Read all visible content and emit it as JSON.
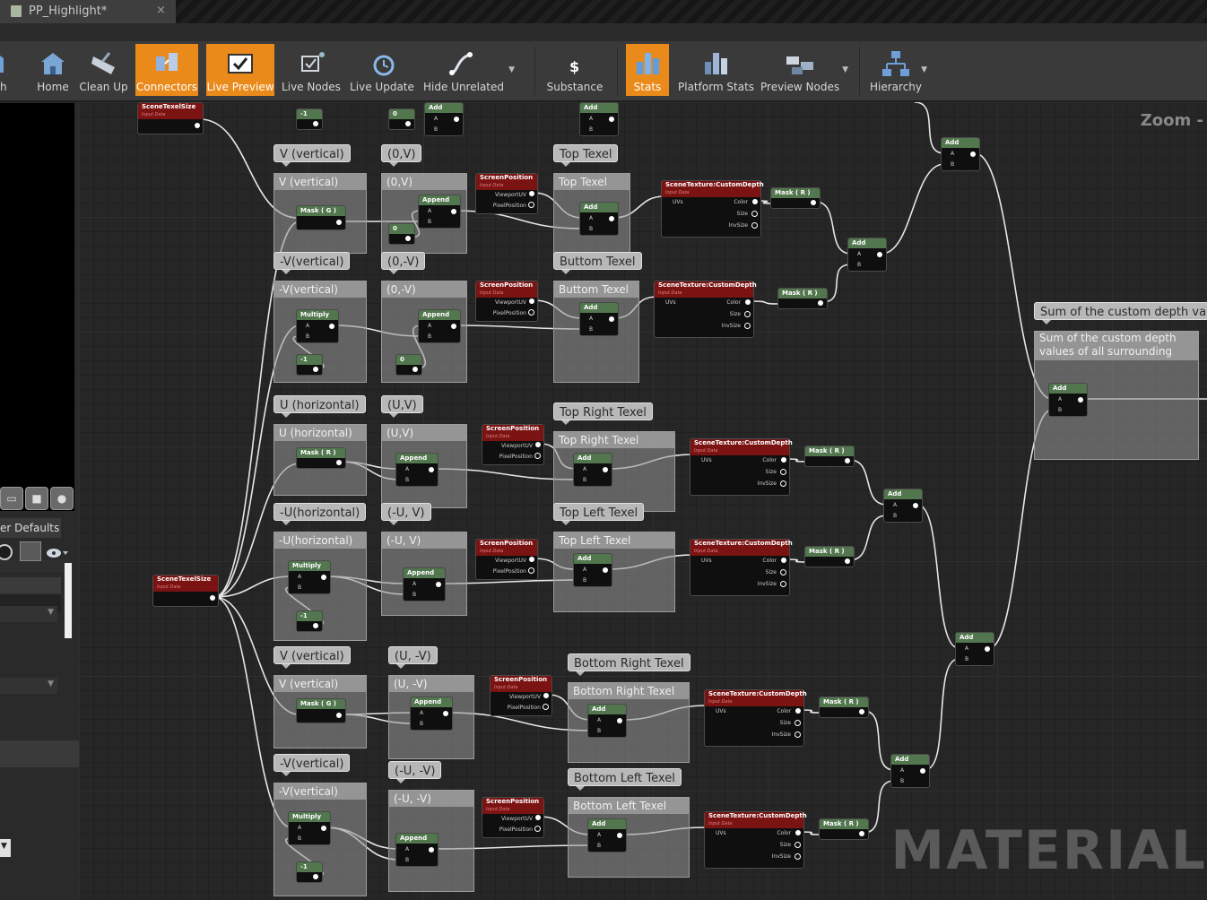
{
  "tab": {
    "title": "PP_Highlight*",
    "close": "×"
  },
  "toolbar": [
    {
      "label": "h",
      "id": "partial",
      "active": false
    },
    {
      "label": "Home",
      "id": "home",
      "active": false
    },
    {
      "label": "Clean Up",
      "id": "cleanup",
      "active": false
    },
    {
      "label": "Connectors",
      "id": "connectors",
      "active": true
    },
    {
      "label": "Live Preview",
      "id": "livepreview",
      "active": true
    },
    {
      "label": "Live Nodes",
      "id": "livenodes",
      "active": false
    },
    {
      "label": "Live Update",
      "id": "liveupdate",
      "active": false
    },
    {
      "label": "Hide Unrelated",
      "id": "hideunrelated",
      "active": false
    },
    {
      "label": "Substance",
      "id": "substance",
      "active": false
    },
    {
      "label": "Stats",
      "id": "stats",
      "active": true
    },
    {
      "label": "Platform Stats",
      "id": "platformstats",
      "active": false
    },
    {
      "label": "Preview Nodes",
      "id": "previewnodes",
      "active": false
    },
    {
      "label": "Hierarchy",
      "id": "hierarchy",
      "active": false
    }
  ],
  "details_tab": "er Defaults",
  "graph": {
    "zoom_label": "Zoom -",
    "watermark": "MATERIAL",
    "bubbles": [
      "V (vertical)",
      "(0,V)",
      "Top Texel",
      "-V(vertical)",
      "(0,-V)",
      "Buttom Texel",
      "U (horizontal)",
      "(U,V)",
      "Top Right Texel",
      "-U(horizontal)",
      "(-U, V)",
      "Top Left Texel",
      "V (vertical)",
      "(U, -V)",
      "Bottom Right Texel",
      "-V(vertical)",
      "(-U, -V)",
      "Bottom Left Texel",
      "Sum of the custom depth values"
    ],
    "comments": [
      "V (vertical)",
      "(0,V)",
      "Top Texel",
      "-V(vertical)",
      "(0,-V)",
      "Buttom Texel",
      "U (horizontal)",
      "(U,V)",
      "Top Right Texel",
      "-U(horizontal)",
      "(-U, V)",
      "Top Left Texel",
      "V (vertical)",
      "(U, -V)",
      "Bottom Right Texel",
      "-V(vertical)",
      "(-U, -V)",
      "Bottom Left Texel",
      "Sum of the custom depth values of all surrounding texels"
    ],
    "node_labels": {
      "add": "Add",
      "append": "Append",
      "multiply": "Multiply",
      "mask_g": "Mask ( G )",
      "mask_r": "Mask ( R )",
      "screen_position": "ScreenPosition",
      "scene_texture": "SceneTexture:CustomDepth",
      "scene_texel_size": "SceneTexelSize",
      "input_data": "Input Data",
      "const_zero": "0",
      "const_neg_one": "-1",
      "pin_a": "A",
      "pin_b": "B",
      "pin_uvs": "UVs",
      "pin_color": "Color",
      "pin_size": "Size",
      "pin_invsize": "InvSize",
      "pin_viewport_uv": "ViewportUV",
      "pin_pixel_position": "PixelPosition"
    }
  }
}
